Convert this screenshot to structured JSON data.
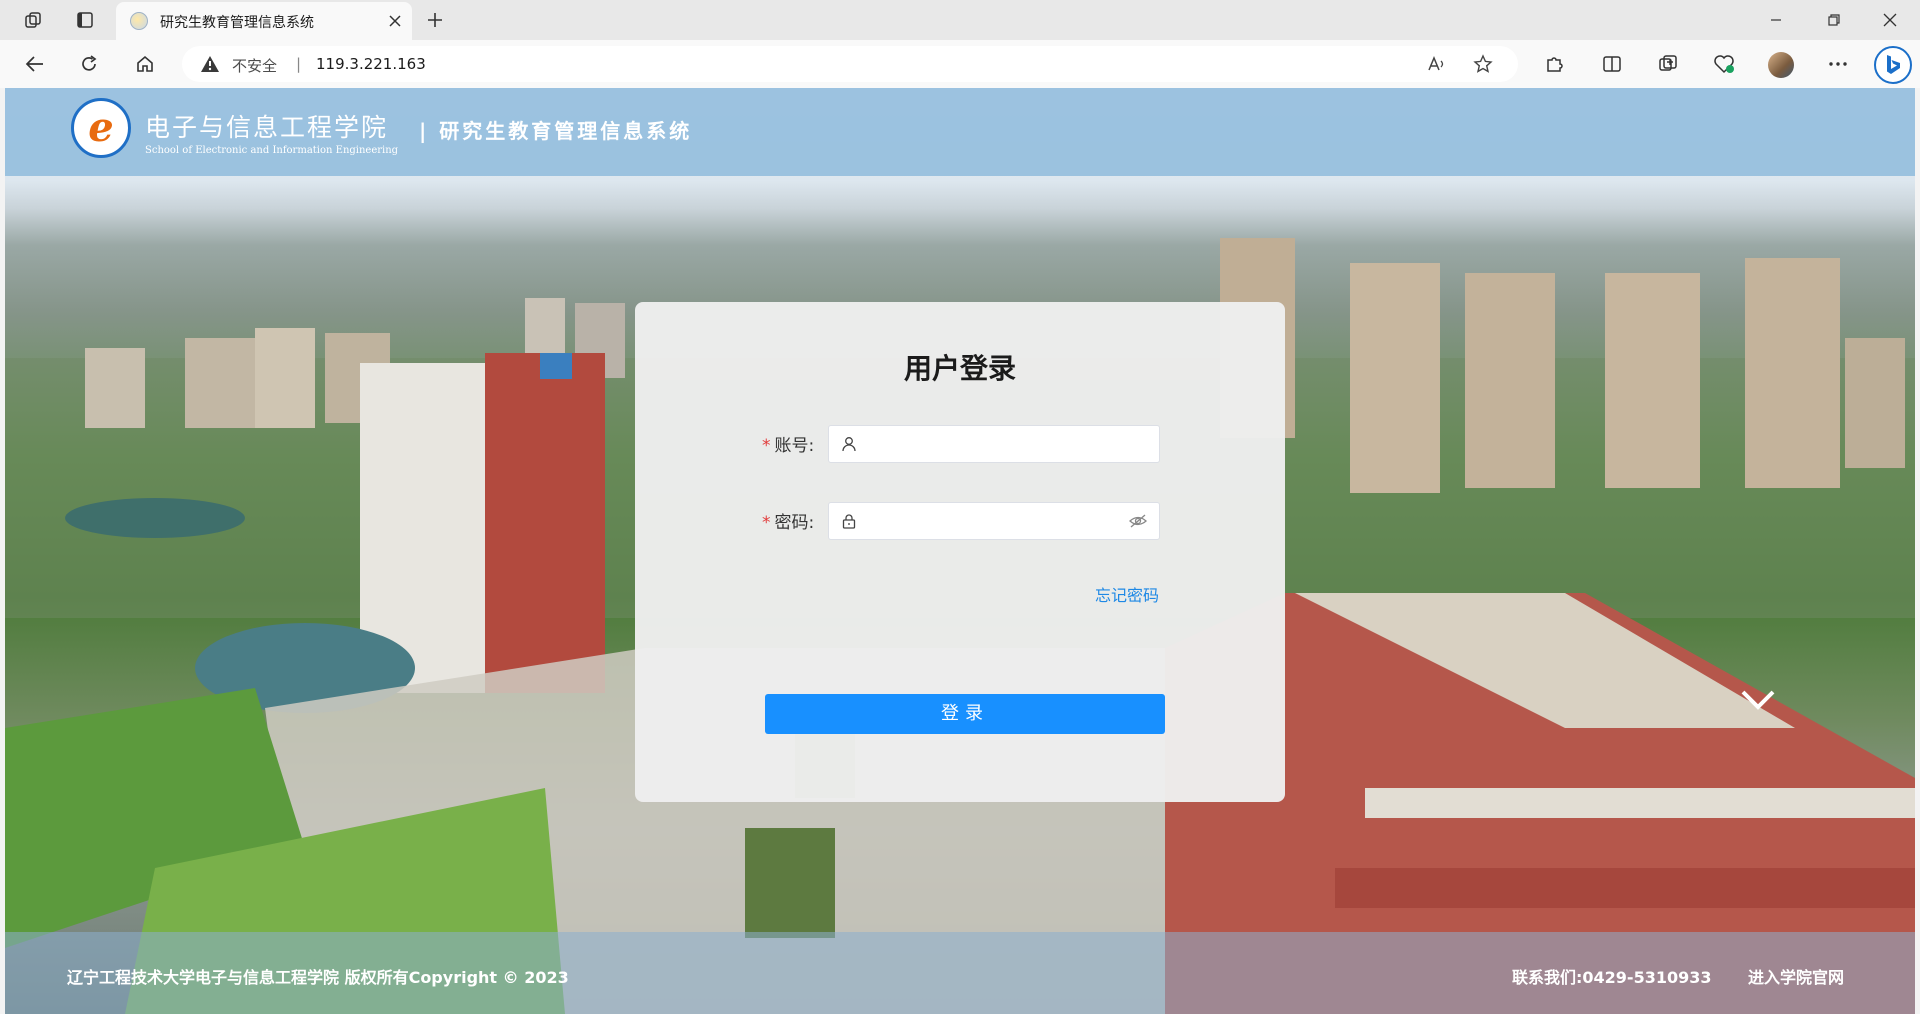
{
  "browser": {
    "tab_title": "研究生教育管理信息系统",
    "security_label": "不安全",
    "separator": "|",
    "url": "119.3.221.163"
  },
  "site": {
    "college_name": "电子与信息工程学院",
    "college_name_en": "School of Electronic and Information Engineering",
    "system_name": "| 研究生教育管理信息系统"
  },
  "login": {
    "title": "用户登录",
    "required_mark": "*",
    "account_label": "账号:",
    "password_label": "密码:",
    "account_value": "",
    "password_value": "",
    "forgot_password": "忘记密码",
    "submit_label": "登录"
  },
  "footer": {
    "copyright": "辽宁工程技术大学电子与信息工程学院 版权所有Copyright © 2023",
    "contact": "联系我们:0429-5310933",
    "official_site": "进入学院官网"
  },
  "colors": {
    "header": "#96bede",
    "primary_button": "#1890ff",
    "link": "#1e88e5",
    "required": "#e23b3b"
  },
  "icons": [
    "workspaces-icon",
    "tab-actions-icon",
    "favicon",
    "close-icon",
    "new-tab-icon",
    "minimize-icon",
    "maximize-icon",
    "window-close-icon",
    "back-icon",
    "refresh-icon",
    "home-icon",
    "warning-icon",
    "read-aloud-icon",
    "favorite-star-icon",
    "extensions-icon",
    "split-screen-icon",
    "collections-icon",
    "browser-essentials-icon",
    "profile-avatar",
    "more-icon",
    "bing-chat-icon",
    "user-icon",
    "lock-icon",
    "eye-hidden-icon",
    "chevron-down-icon"
  ]
}
